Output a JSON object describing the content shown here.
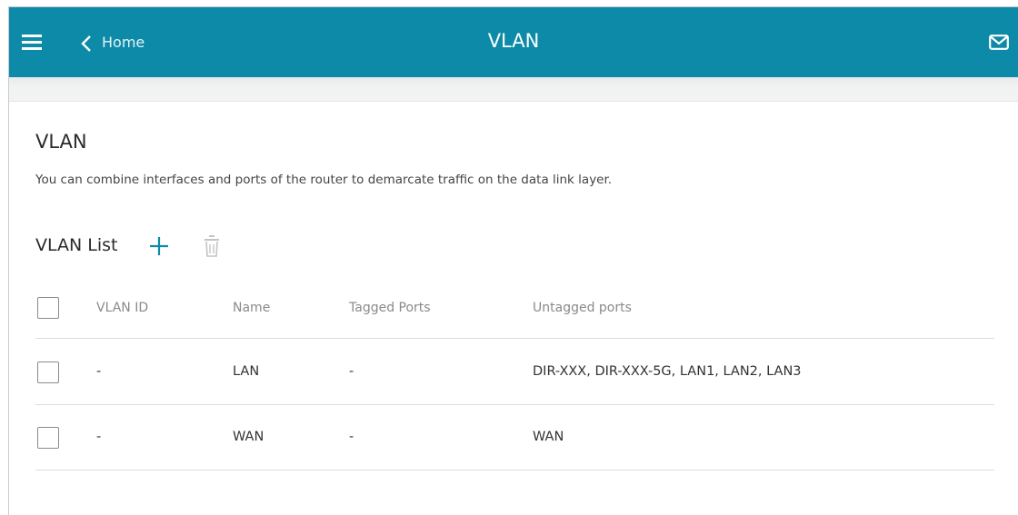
{
  "header": {
    "back_label": "Home",
    "title": "VLAN",
    "menu_icon": "hamburger-menu-icon",
    "back_icon": "chevron-left-icon",
    "mail_icon": "envelope-icon",
    "bar_color": "#0d8aa8"
  },
  "main": {
    "title": "VLAN",
    "description": "You can combine interfaces and ports of the router to demarcate traffic on the data link layer.",
    "list": {
      "title": "VLAN List",
      "add_icon": "plus-icon",
      "delete_icon": "trash-icon",
      "columns": [
        "VLAN ID",
        "Name",
        "Tagged Ports",
        "Untagged ports"
      ],
      "rows": [
        {
          "vlan_id": "-",
          "name": "LAN",
          "tagged": "-",
          "untagged": "DIR-XXX, DIR-XXX-5G, LAN1, LAN2, LAN3"
        },
        {
          "vlan_id": "-",
          "name": "WAN",
          "tagged": "-",
          "untagged": "WAN"
        }
      ]
    }
  }
}
